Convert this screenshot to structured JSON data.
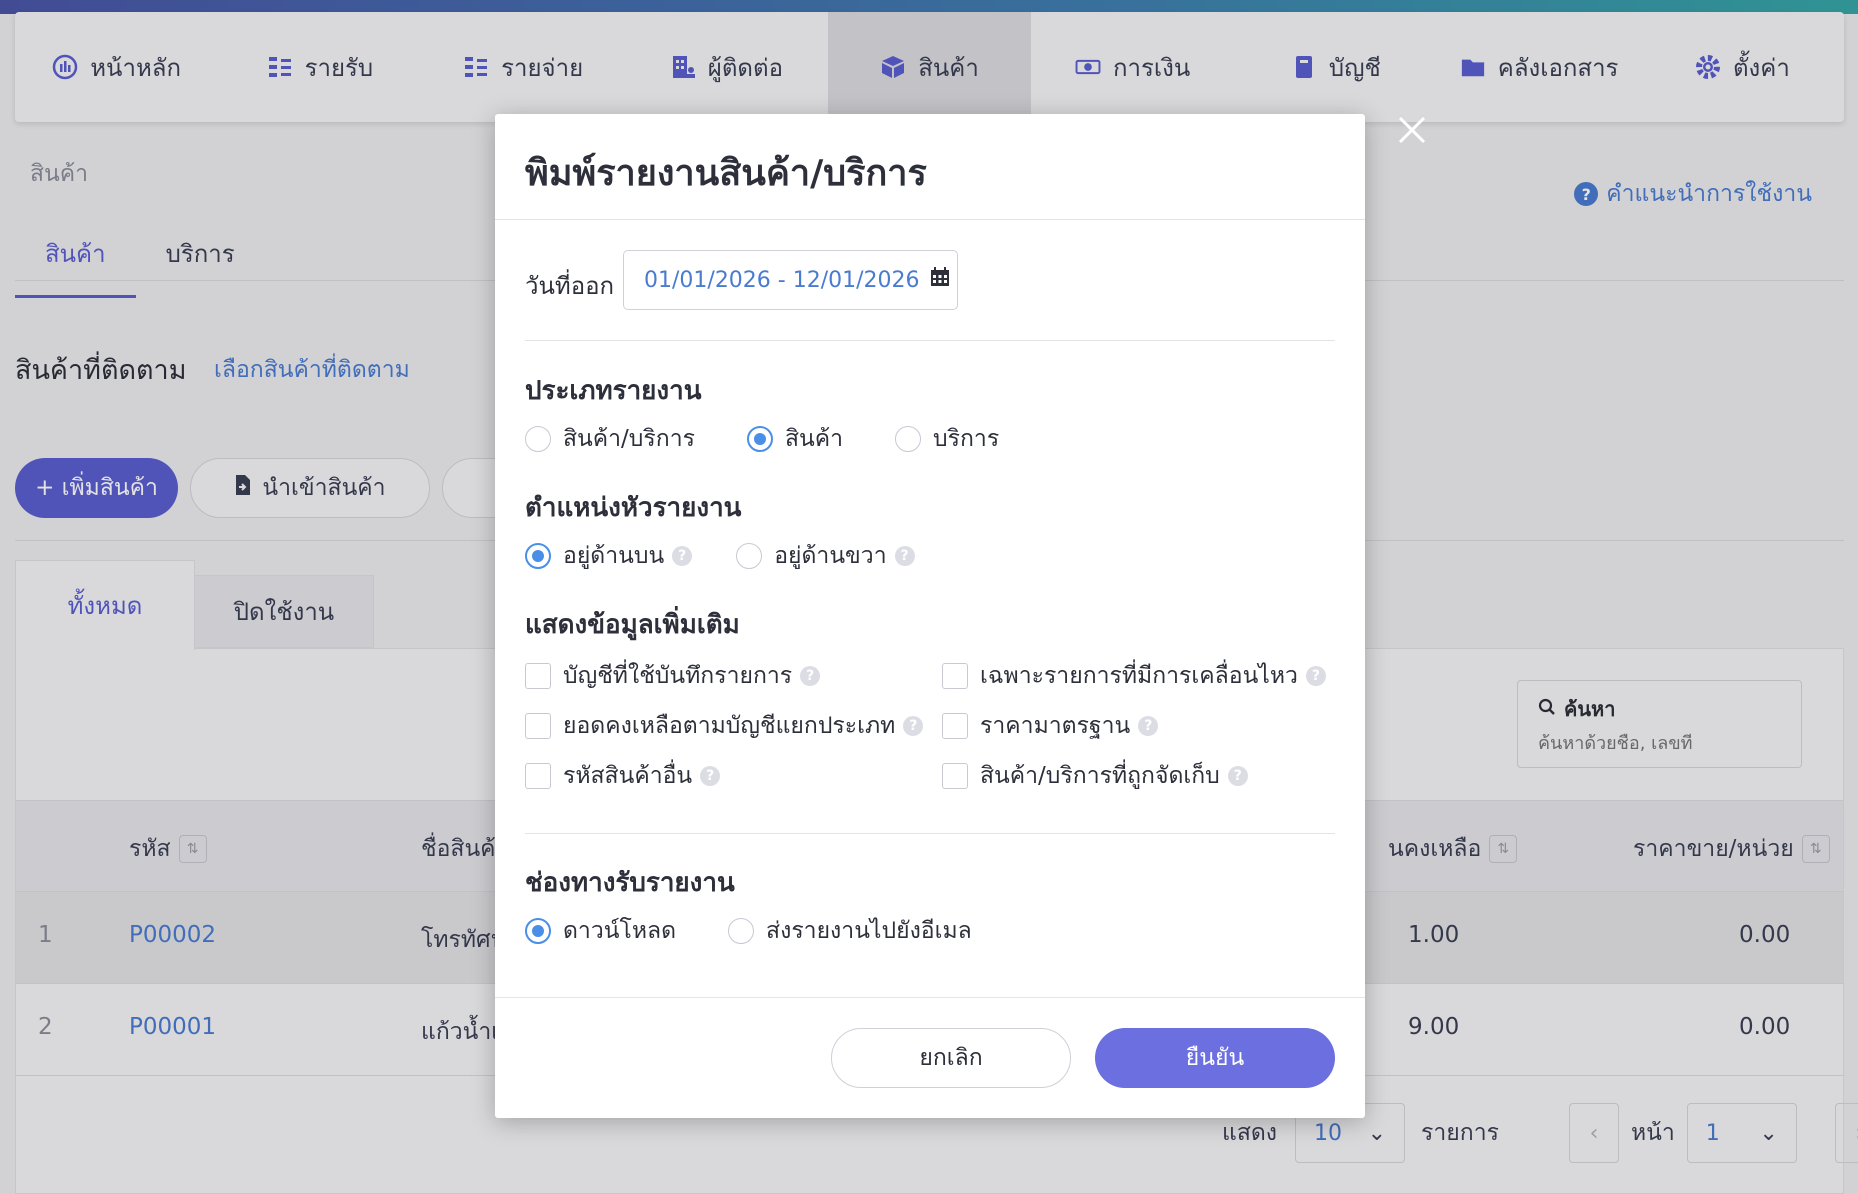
{
  "nav": {
    "items": [
      {
        "label": "หน้าหลัก",
        "icon": "dashboard-icon"
      },
      {
        "label": "รายรับ",
        "icon": "income-icon"
      },
      {
        "label": "รายจ่าย",
        "icon": "expense-icon"
      },
      {
        "label": "ผู้ติดต่อ",
        "icon": "contacts-icon"
      },
      {
        "label": "สินค้า",
        "icon": "box-icon",
        "active": true
      },
      {
        "label": "การเงิน",
        "icon": "money-icon"
      },
      {
        "label": "บัญชี",
        "icon": "book-icon"
      },
      {
        "label": "คลังเอกสาร",
        "icon": "folder-icon"
      },
      {
        "label": "ตั้งค่า",
        "icon": "gear-icon"
      }
    ]
  },
  "page": {
    "breadcrumb": "สินค้า",
    "help_link": "คำแนะนำการใช้งาน",
    "subtabs": [
      "สินค้า",
      "บริการ"
    ],
    "followed_title": "สินค้าที่ติดตาม",
    "followed_link": "เลือกสินค้าที่ติดตาม",
    "add_button": "+ เพิ่มสินค้า",
    "import_button": "นำเข้าสินค้า",
    "card_tabs": [
      "ทั้งหมด",
      "ปิดใช้งาน"
    ],
    "search": {
      "label": "ค้นหา",
      "placeholder": "ค้นหาด้วยชื่อ, เลขที่"
    }
  },
  "table": {
    "headers": {
      "code": "รหัส",
      "name": "ชื่อสินค้",
      "balance": "นคงเหลือ",
      "price": "ราคาขาย/หน่วย"
    },
    "rows": [
      {
        "num": "1",
        "code": "P00002",
        "name": "โทรทัศน",
        "balance": "1.00",
        "price": "0.00"
      },
      {
        "num": "2",
        "code": "P00001",
        "name": "แก้วน้ำเ",
        "balance": "9.00",
        "price": "0.00"
      }
    ]
  },
  "pagination": {
    "show_label": "แสดง",
    "per_page": "10",
    "items_label": "รายการ",
    "page_label": "หน้า",
    "page": "1"
  },
  "modal": {
    "title": "พิมพ์รายงานสินค้า/บริการ",
    "date_label": "วันที่ออก",
    "date_range": "01/01/2026 - 12/01/2026",
    "report_type": {
      "title": "ประเภทรายงาน",
      "options": [
        "สินค้า/บริการ",
        "สินค้า",
        "บริการ"
      ],
      "selected": "สินค้า"
    },
    "header_position": {
      "title": "ตำแหน่งหัวรายงาน",
      "options": [
        "อยู่ด้านบน",
        "อยู่ด้านขวา"
      ],
      "selected": "อยู่ด้านบน"
    },
    "extra_info": {
      "title": "แสดงข้อมูลเพิ่มเติม",
      "options": [
        "บัญชีที่ใช้บันทึกรายการ",
        "เฉพาะรายการที่มีการเคลื่อนไหว",
        "ยอดคงเหลือตามบัญชีแยกประเภท",
        "ราคามาตรฐาน",
        "รหัสสินค้าอื่น",
        "สินค้า/บริการที่ถูกจัดเก็บ"
      ]
    },
    "channel": {
      "title": "ช่องทางรับรายงาน",
      "options": [
        "ดาวน์โหลด",
        "ส่งรายงานไปยังอีเมล"
      ],
      "selected": "ดาวน์โหลด"
    },
    "cancel_button": "ยกเลิก",
    "confirm_button": "ยืนยัน"
  },
  "colors": {
    "accent": "#5a5fd0",
    "link": "#4a7bd0",
    "radio_selected": "#4a8fe7",
    "confirm_button": "#6c6fe0"
  }
}
